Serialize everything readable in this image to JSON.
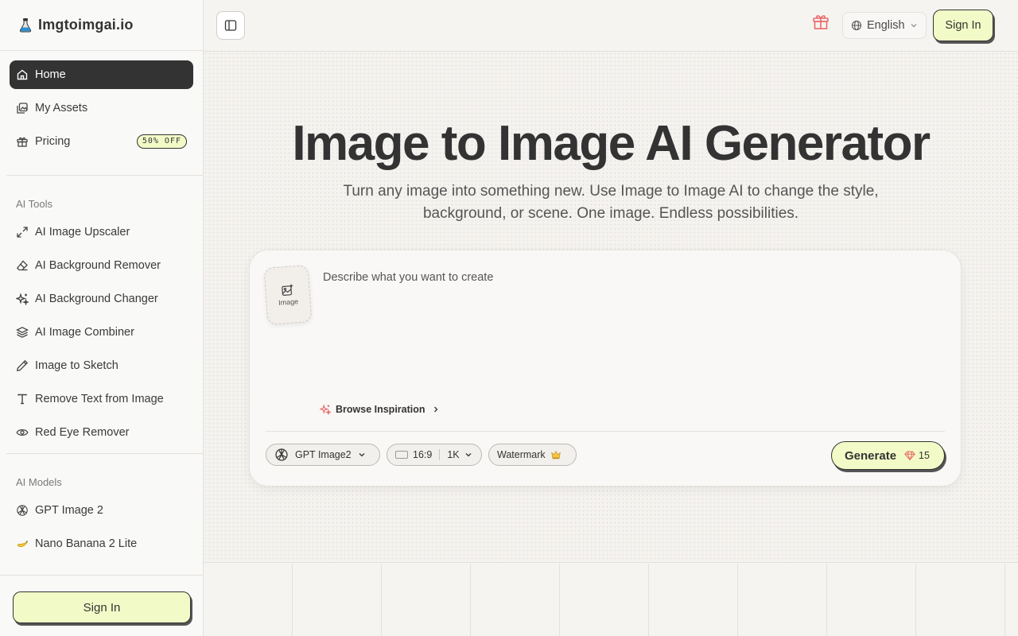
{
  "app": {
    "brand": "Imgtoimgai.io"
  },
  "sidebar": {
    "nav": [
      {
        "label": "Home",
        "icon": "home-icon",
        "active": true
      },
      {
        "label": "My Assets",
        "icon": "assets-icon"
      },
      {
        "label": "Pricing",
        "icon": "gift-icon",
        "badge": "50% OFF"
      }
    ],
    "tools_title": "AI Tools",
    "tools": [
      {
        "label": "AI Image Upscaler",
        "icon": "expand-icon"
      },
      {
        "label": "AI Background Remover",
        "icon": "eraser-icon"
      },
      {
        "label": "AI Background Changer",
        "icon": "sparkles-icon"
      },
      {
        "label": "AI Image Combiner",
        "icon": "layers-icon"
      },
      {
        "label": "Image to Sketch",
        "icon": "pencil-icon"
      },
      {
        "label": "Remove Text from Image",
        "icon": "text-icon"
      },
      {
        "label": "Red Eye Remover",
        "icon": "eye-icon"
      }
    ],
    "models_title": "AI Models",
    "models": [
      {
        "label": "GPT Image 2",
        "icon": "openai-icon"
      },
      {
        "label": "Nano Banana 2 Lite",
        "icon": "banana-icon"
      }
    ],
    "signin_label": "Sign In"
  },
  "topbar": {
    "language": "English",
    "signin_label": "Sign In"
  },
  "hero": {
    "title": "Image to Image AI Generator",
    "subtitle": "Turn any image into something new. Use Image to Image AI to change the style, background, or scene. One image. Endless possibilities."
  },
  "composer": {
    "upload_label": "Image",
    "prompt_placeholder": "Describe what you want to create",
    "inspiration_label": "Browse Inspiration",
    "model": "GPT Image2",
    "ratio": "16:9",
    "resolution": "1K",
    "watermark_label": "Watermark",
    "generate_label": "Generate",
    "credits_cost": "15"
  },
  "colors": {
    "accent": "#f2fbc7",
    "active_nav": "#333333",
    "gift": "#e86a6a"
  }
}
